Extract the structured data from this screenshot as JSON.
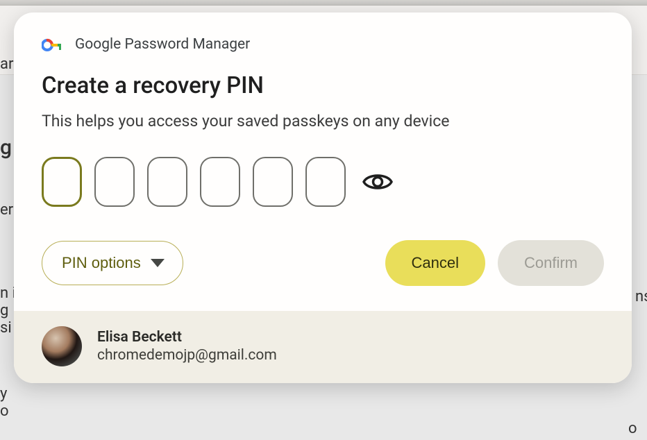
{
  "header": {
    "app_name": "Google Password Manager"
  },
  "body": {
    "heading": "Create a recovery PIN",
    "subheading": "This helps you access your saved passkeys on any device",
    "pin_digits": [
      "",
      "",
      "",
      "",
      "",
      ""
    ]
  },
  "controls": {
    "pin_options_label": "PIN options",
    "cancel_label": "Cancel",
    "confirm_label": "Confirm"
  },
  "user": {
    "name": "Elisa Beckett",
    "email": "chromedemojp@gmail.com"
  },
  "background": {
    "t1": "ar",
    "t2": "g",
    "t3": "er",
    "t4": "n i",
    "t5": "g",
    "t6": "si",
    "t7": "y",
    "t8": "o",
    "t9": "o",
    "t10": "ns"
  }
}
